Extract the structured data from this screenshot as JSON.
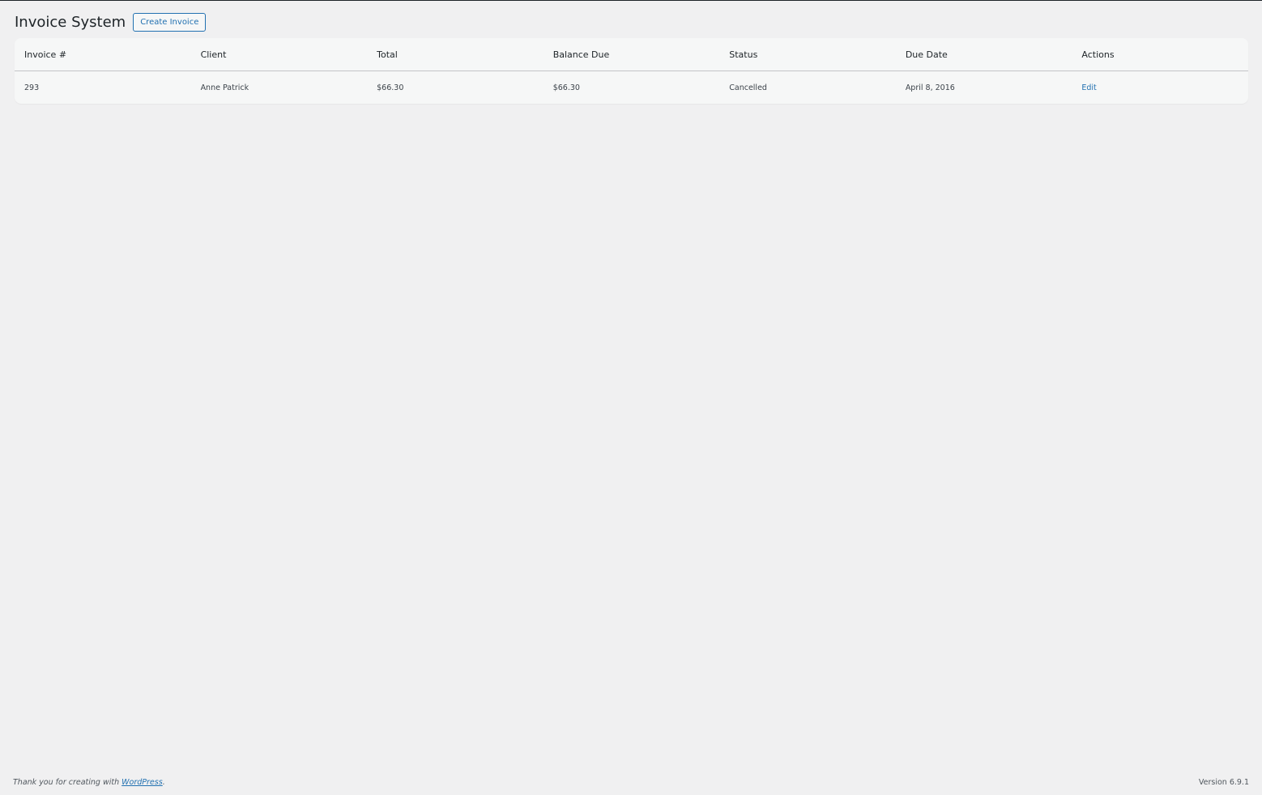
{
  "header": {
    "title": "Invoice System",
    "create_label": "Create Invoice"
  },
  "table": {
    "columns": [
      "Invoice #",
      "Client",
      "Total",
      "Balance Due",
      "Status",
      "Due Date",
      "Actions"
    ],
    "rows": [
      {
        "invoice": "293",
        "client": "Anne Patrick",
        "total": "$66.30",
        "balance": "$66.30",
        "status": "Cancelled",
        "due": "April 8, 2016",
        "action": "Edit"
      }
    ]
  },
  "footer": {
    "thanks": "Thank you for creating with ",
    "link": "WordPress",
    "period": ".",
    "version": "Version 6.9.1"
  }
}
